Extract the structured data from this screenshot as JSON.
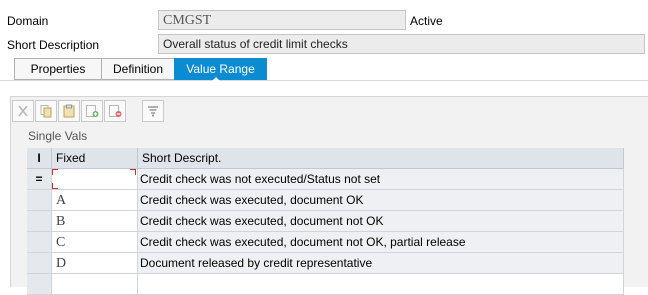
{
  "fields": {
    "domain": {
      "label": "Domain",
      "value": "CMGST",
      "status": "Active"
    },
    "short_description": {
      "label": "Short Description",
      "value": "Overall status of credit limit checks"
    }
  },
  "tabs": [
    {
      "label": "Properties",
      "active": false
    },
    {
      "label": "Definition",
      "active": false
    },
    {
      "label": "Value Range",
      "active": true
    }
  ],
  "toolbar": {
    "buttons": [
      {
        "name": "cut-icon"
      },
      {
        "name": "copy-icon"
      },
      {
        "name": "paste-icon"
      },
      {
        "name": "insert-row-icon"
      },
      {
        "name": "delete-row-icon"
      },
      {
        "name": "filter-icon"
      }
    ]
  },
  "single_vals": {
    "title": "Single Vals",
    "columns": {
      "indicator": "I",
      "fixed": "Fixed",
      "description": "Short Descript."
    },
    "rows": [
      {
        "indicator": "=",
        "fixed": "",
        "description": "Credit check was not executed/Status not set"
      },
      {
        "indicator": "",
        "fixed": "A",
        "description": "Credit check was executed, document OK"
      },
      {
        "indicator": "",
        "fixed": "B",
        "description": "Credit check was executed, document not OK"
      },
      {
        "indicator": "",
        "fixed": "C",
        "description": "Credit check was executed, document not OK, partial release"
      },
      {
        "indicator": "",
        "fixed": "D",
        "description": "Document released by credit representative"
      },
      {
        "indicator": "",
        "fixed": "",
        "description": ""
      }
    ]
  },
  "colors": {
    "tab_active": "#0a8bd2",
    "header_bg": "#dfe4ea",
    "selection_marker": "#c53030"
  }
}
